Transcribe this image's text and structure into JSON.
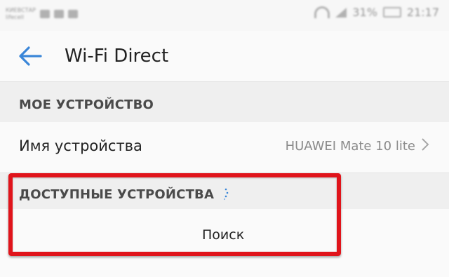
{
  "status_bar": {
    "carrier_line1": "КИЕВСТАР",
    "carrier_line2": "lifecell",
    "battery": "31%",
    "time": "21:17"
  },
  "header": {
    "title": "Wi-Fi Direct",
    "back_icon": "arrow-left-icon",
    "accent_color": "#3a86d8"
  },
  "my_device": {
    "section_title": "МОЕ УСТРОЙСТВО",
    "row_label": "Имя устройства",
    "row_value": "HUAWEI Mate 10 lite",
    "row_icon": "chevron-right-icon"
  },
  "available_devices": {
    "section_title": "ДОСТУПНЫЕ УСТРОЙСТВА",
    "status_icon": "loading-spinner-icon",
    "search_label": "Поиск"
  },
  "annotation": {
    "highlight_color": "#e0141b"
  }
}
